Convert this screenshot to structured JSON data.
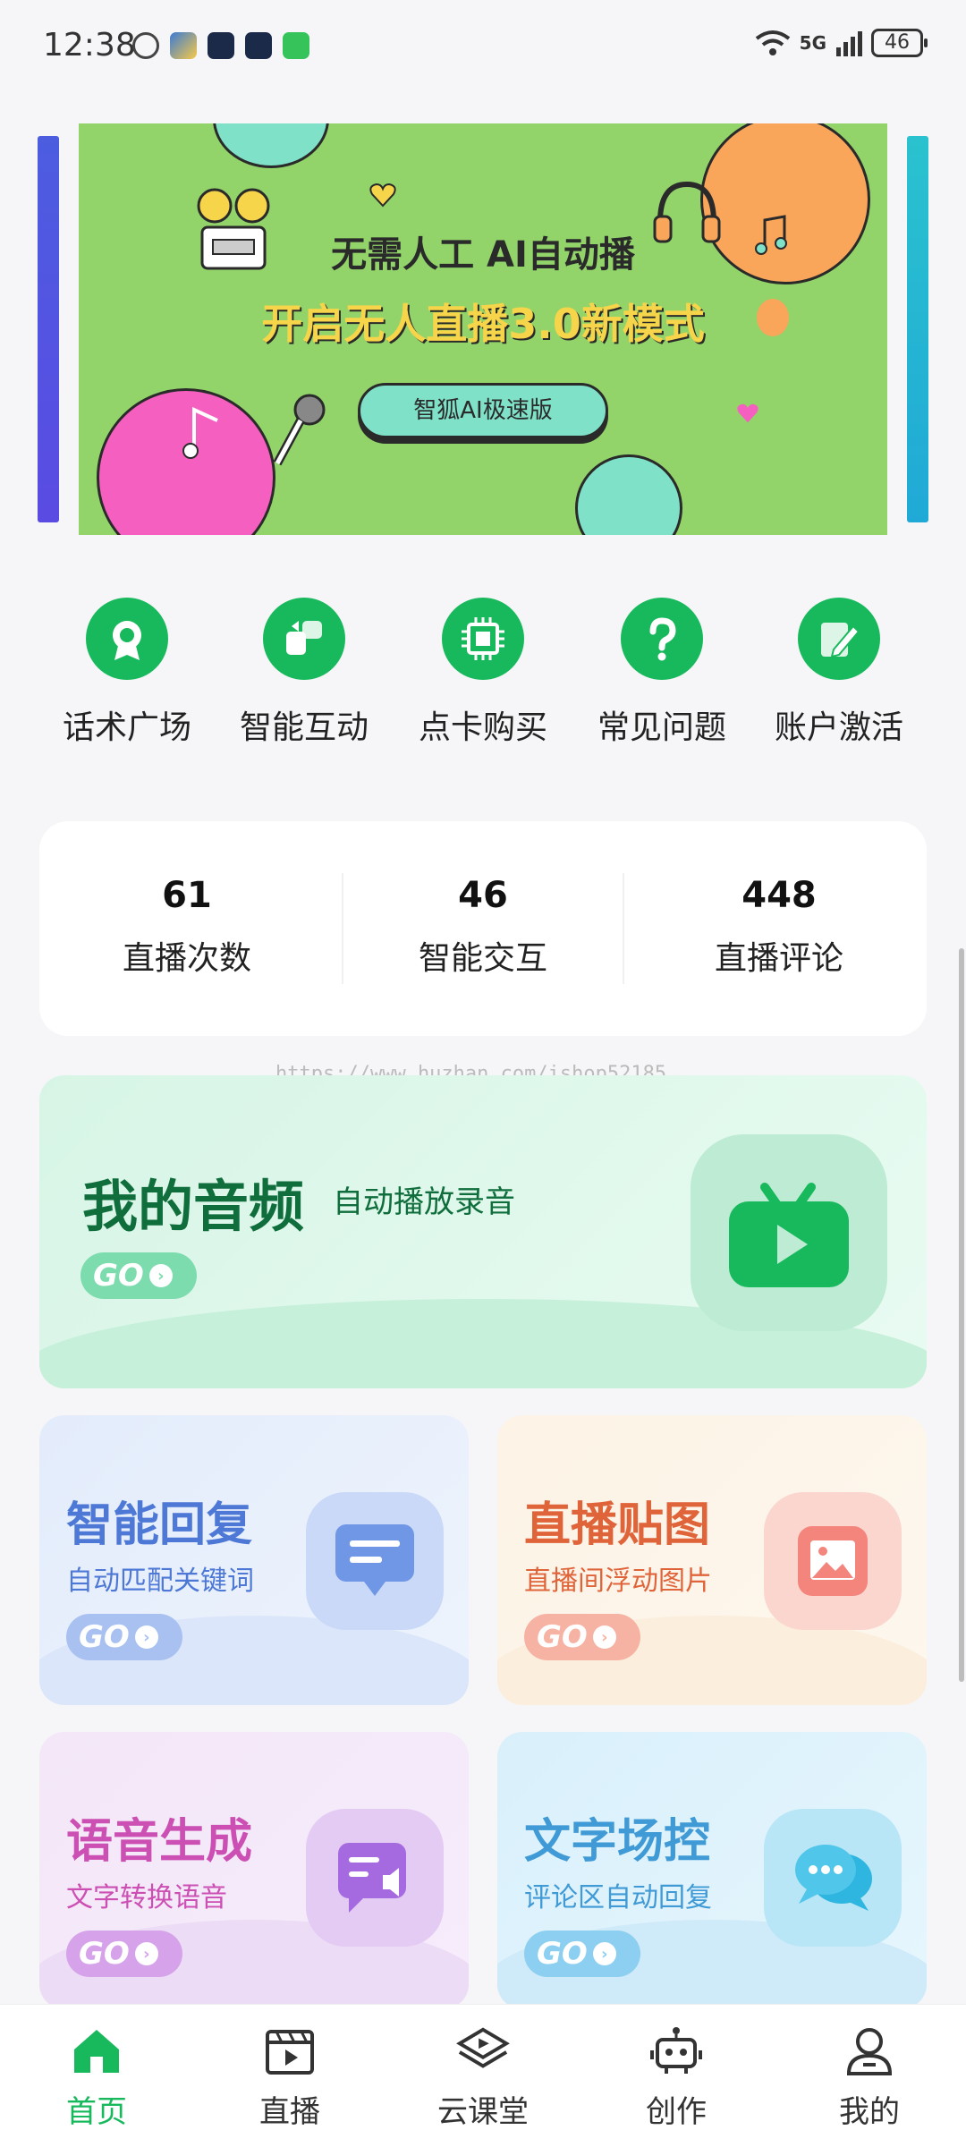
{
  "status_bar": {
    "time": "12:38",
    "signal": "5G",
    "battery": "46"
  },
  "banner": {
    "line1": "无需人工 AI自动播",
    "line2": "开启无人直播3.0新模式",
    "button": "智狐AI极速版"
  },
  "quick_menu": [
    {
      "label": "话术广场",
      "icon": "badge-icon"
    },
    {
      "label": "智能互动",
      "icon": "interaction-icon"
    },
    {
      "label": "点卡购买",
      "icon": "chip-icon"
    },
    {
      "label": "常见问题",
      "icon": "question-icon"
    },
    {
      "label": "账户激活",
      "icon": "edit-icon"
    }
  ],
  "stats": [
    {
      "value": "61",
      "label": "直播次数"
    },
    {
      "value": "46",
      "label": "智能交互"
    },
    {
      "value": "448",
      "label": "直播评论"
    }
  ],
  "watermark": "https://www.huzhan.com/ishop52185",
  "cards": {
    "audio": {
      "title": "我的音频",
      "subtitle": "自动播放录音",
      "go": "GO",
      "color": "#0f8f4a"
    },
    "reply": {
      "title": "智能回复",
      "subtitle": "自动匹配关键词",
      "go": "GO",
      "color": "#4d78d6"
    },
    "sticker": {
      "title": "直播贴图",
      "subtitle": "直播间浮动图片",
      "go": "GO",
      "color": "#e0643a"
    },
    "voice": {
      "title": "语音生成",
      "subtitle": "文字转换语音",
      "go": "GO",
      "color": "#cc4fb3"
    },
    "text": {
      "title": "文字场控",
      "subtitle": "评论区自动回复",
      "go": "GO",
      "color": "#3f9ad6"
    }
  },
  "nav": [
    {
      "label": "首页",
      "icon": "home-icon",
      "active": true
    },
    {
      "label": "直播",
      "icon": "video-icon"
    },
    {
      "label": "云课堂",
      "icon": "layers-icon"
    },
    {
      "label": "创作",
      "icon": "robot-icon"
    },
    {
      "label": "我的",
      "icon": "user-icon"
    }
  ],
  "colors": {
    "accent": "#18b95c",
    "banner_bg": "#92d46a"
  }
}
